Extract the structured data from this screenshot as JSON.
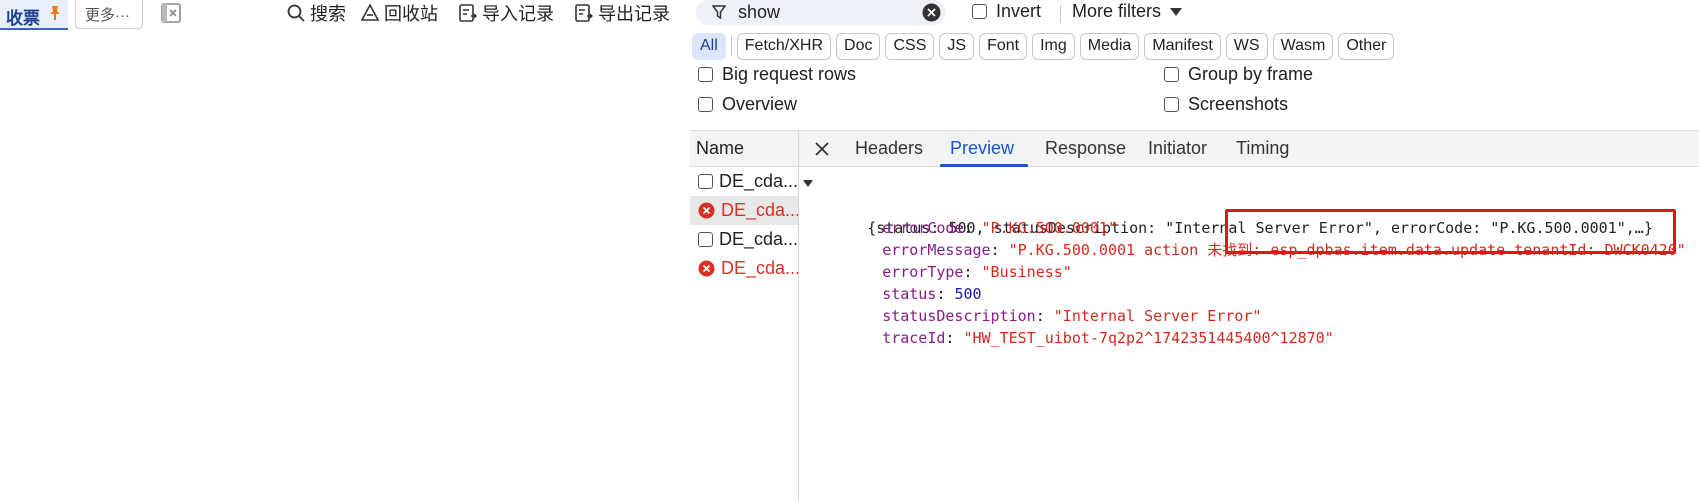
{
  "app_toolbar": {
    "active_tab": "收票",
    "more_tab": "更多···",
    "tools": [
      {
        "label": "搜索",
        "icon": "search-icon"
      },
      {
        "label": "回收站",
        "icon": "recycle-bin-icon"
      },
      {
        "label": "导入记录",
        "icon": "import-record-icon"
      },
      {
        "label": "导出记录",
        "icon": "export-record-icon"
      }
    ]
  },
  "filter": {
    "value": "show",
    "invert_label": "Invert",
    "more_filters_label": "More filters"
  },
  "request_types": [
    "All",
    "Fetch/XHR",
    "Doc",
    "CSS",
    "JS",
    "Font",
    "Img",
    "Media",
    "Manifest",
    "WS",
    "Wasm",
    "Other"
  ],
  "options": {
    "big_request_rows": "Big request rows",
    "group_by_frame": "Group by frame",
    "overview": "Overview",
    "screenshots": "Screenshots"
  },
  "requests": {
    "name_header": "Name",
    "rows": [
      {
        "name": "DE_cda...",
        "error": false,
        "selected": false
      },
      {
        "name": "DE_cda...",
        "error": true,
        "selected": true
      },
      {
        "name": "DE_cda...",
        "error": false,
        "selected": false
      },
      {
        "name": "DE_cda...",
        "error": true,
        "selected": false
      }
    ]
  },
  "detail_tabs": [
    "Headers",
    "Preview",
    "Response",
    "Initiator",
    "Timing"
  ],
  "active_detail_tab": "Preview",
  "preview": {
    "summary": "{status: 500, statusDescription: \"Internal Server Error\", errorCode: \"P.KG.500.0001\",…}",
    "fields": [
      {
        "key": "errorCode",
        "value": "\"P.KG.500.0001\"",
        "type": "string"
      },
      {
        "key": "errorMessage",
        "value": "\"P.KG.500.0001 action 未找到: esp_dpbas.item.data.update tenantId: DWCK0420\"",
        "type": "string"
      },
      {
        "key": "errorType",
        "value": "\"Business\"",
        "type": "string"
      },
      {
        "key": "status",
        "value": "500",
        "type": "number"
      },
      {
        "key": "statusDescription",
        "value": "\"Internal Server Error\"",
        "type": "string"
      },
      {
        "key": "traceId",
        "value": "\"HW_TEST_uibot-7q2p2^1742351445400^12870\"",
        "type": "string"
      }
    ]
  },
  "colors": {
    "accent": "#1a56c4",
    "error": "#d93025",
    "highlight": "#e4141b"
  }
}
